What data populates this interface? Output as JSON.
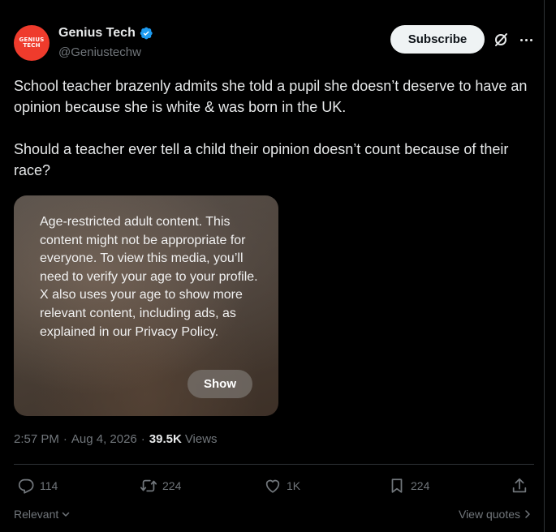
{
  "author": {
    "avatar_text_line1": "GENIUS",
    "avatar_text_line2": "TECH",
    "display_name": "Genius Tech",
    "handle": "@Geniustechw",
    "verified": true
  },
  "header": {
    "subscribe_label": "Subscribe",
    "icons": [
      "grok-icon",
      "more-icon"
    ]
  },
  "post": {
    "paragraphs": [
      "School teacher brazenly admits she told a pupil she doesn’t deserve to have an opinion because she is white & was born in the UK.",
      "Should a teacher ever tell a child their opinion doesn’t count because of their race?"
    ]
  },
  "media": {
    "warning_text": "Age-restricted adult content. This content might not be appropriate for everyone. To view this media, you’ll need to verify your age to your profile. X also uses your age to show more relevant content, including ads, as explained in our Privacy Policy.",
    "show_label": "Show"
  },
  "meta": {
    "time": "2:57 PM",
    "separator": "·",
    "date": "Aug 4, 2026",
    "views_count": "39.5K",
    "views_label": "Views"
  },
  "actions": {
    "replies": "114",
    "reposts": "224",
    "likes": "1K",
    "bookmarks": "224"
  },
  "footer": {
    "relevant_label": "Relevant",
    "view_quotes_label": "View quotes"
  },
  "colors": {
    "background": "#000000",
    "text": "#e7e9ea",
    "muted": "#71767b",
    "verified_blue": "#1d9bf0",
    "avatar_red": "#ef3b2c",
    "divider": "#2f3336"
  }
}
